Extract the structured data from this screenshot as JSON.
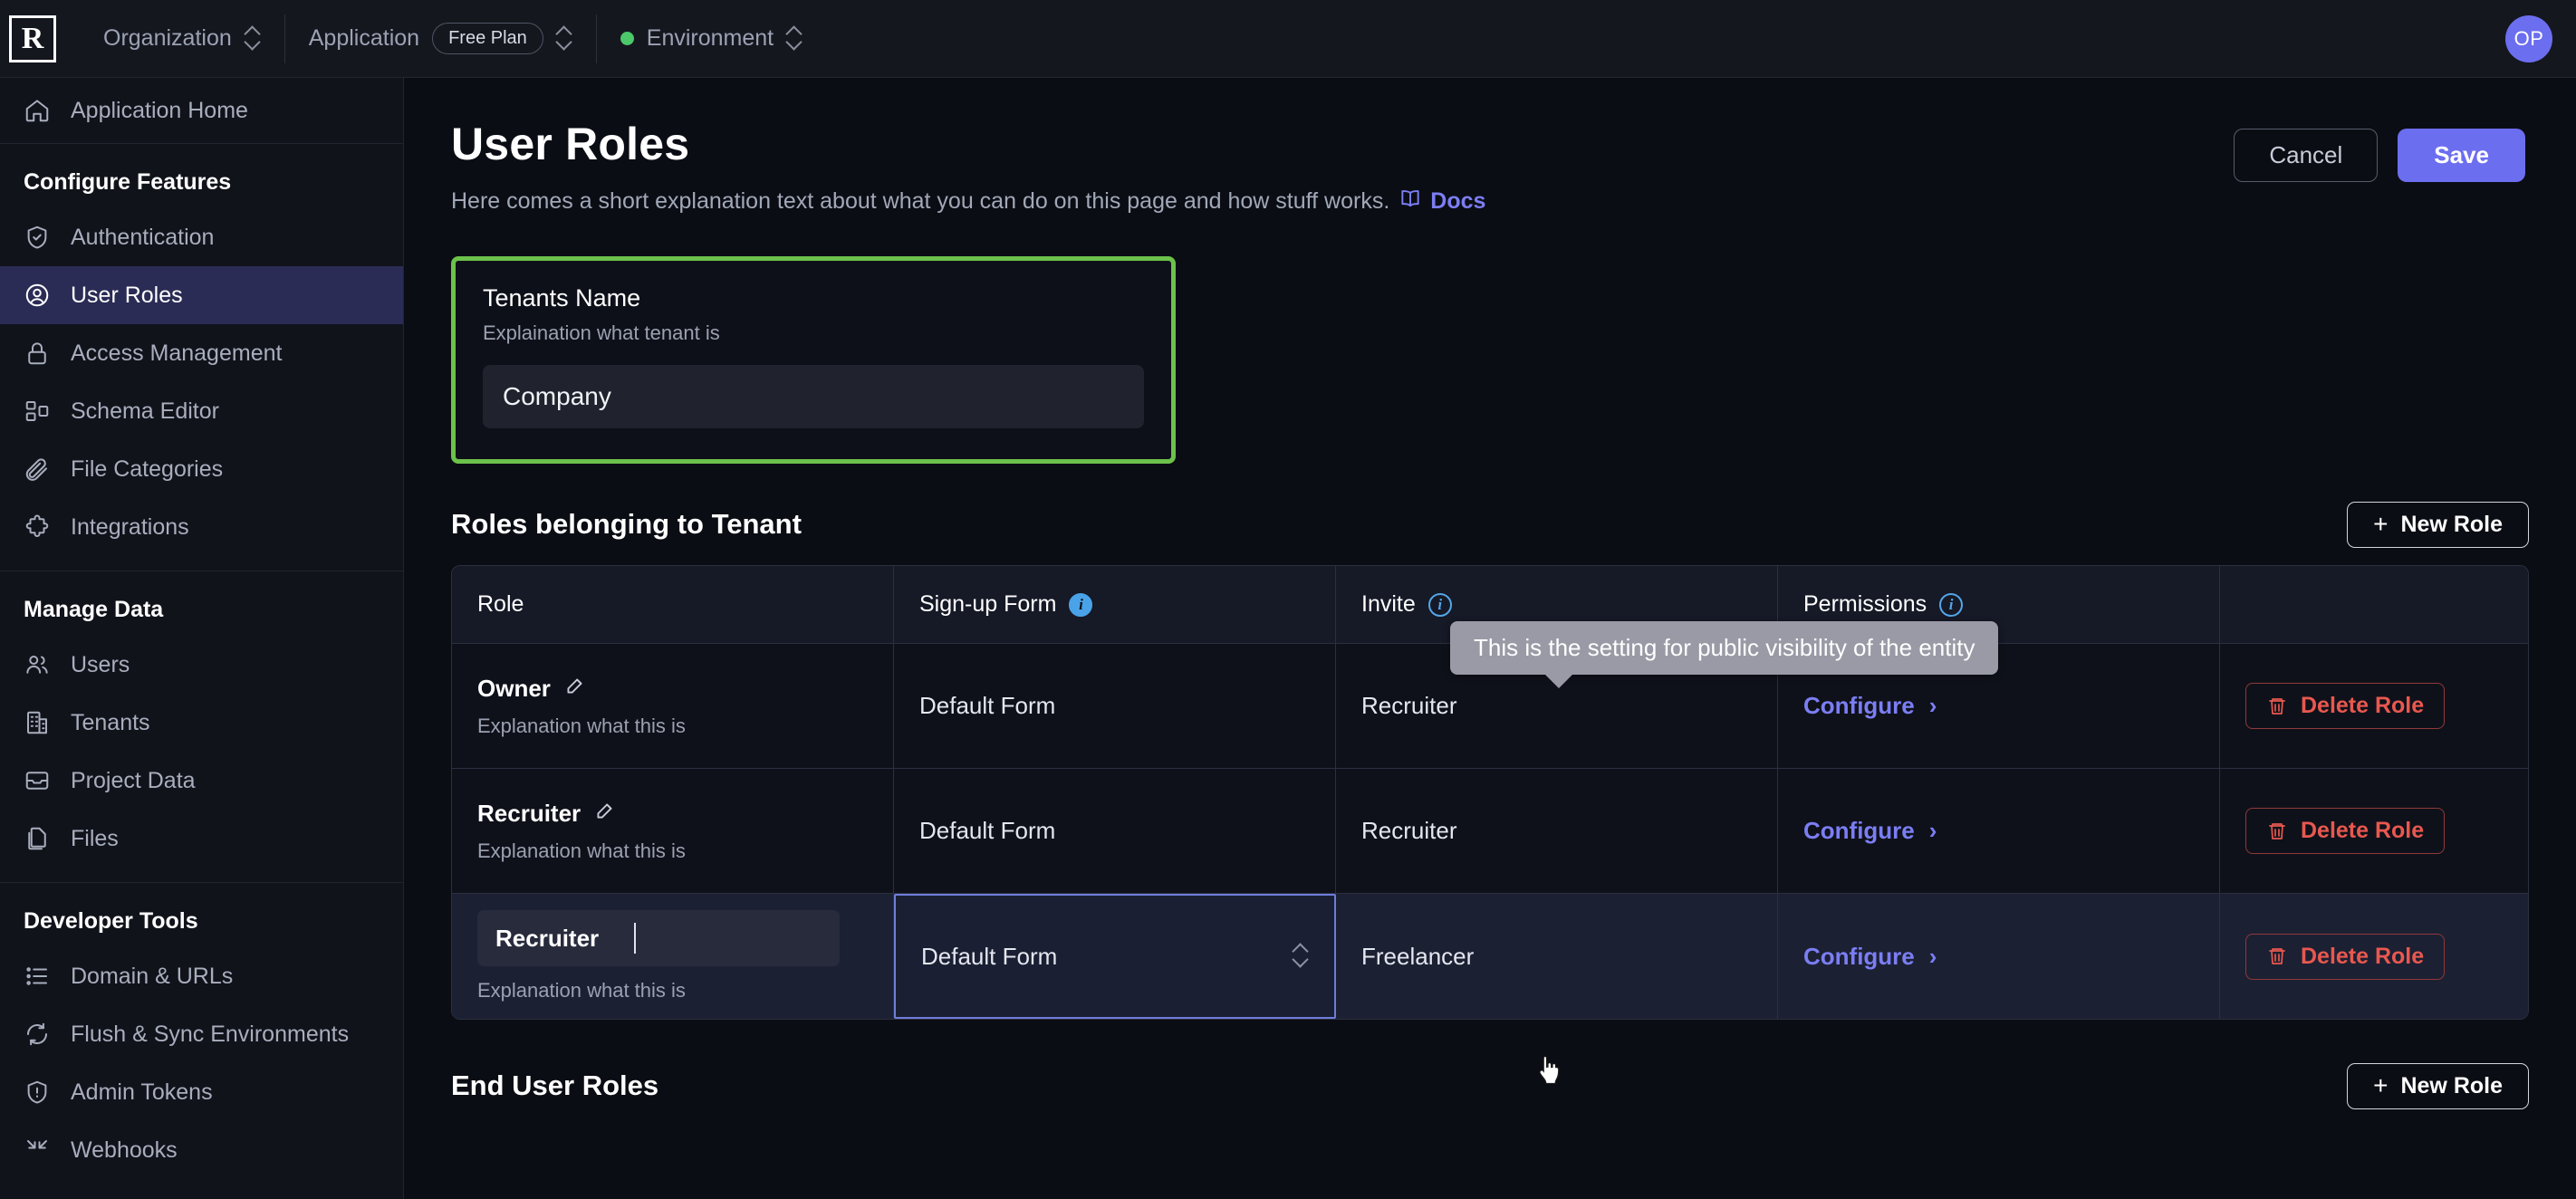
{
  "topbar": {
    "logo_text": "R",
    "org_label": "Organization",
    "app_label": "Application",
    "plan_badge": "Free Plan",
    "env_label": "Environment",
    "avatar_initials": "OP"
  },
  "sidebar": {
    "home_item": {
      "label": "Application Home",
      "icon": "home-icon"
    },
    "groups": [
      {
        "heading": "Configure Features",
        "items": [
          {
            "label": "Authentication",
            "icon": "shield-check-icon",
            "active": false
          },
          {
            "label": "User Roles",
            "icon": "user-circle-icon",
            "active": true
          },
          {
            "label": "Access Management",
            "icon": "lock-icon",
            "active": false
          },
          {
            "label": "Schema Editor",
            "icon": "schema-icon",
            "active": false
          },
          {
            "label": "File Categories",
            "icon": "paperclip-icon",
            "active": false
          },
          {
            "label": "Integrations",
            "icon": "puzzle-icon",
            "active": false
          }
        ]
      },
      {
        "heading": "Manage Data",
        "items": [
          {
            "label": "Users",
            "icon": "users-icon",
            "active": false
          },
          {
            "label": "Tenants",
            "icon": "building-icon",
            "active": false
          },
          {
            "label": "Project Data",
            "icon": "tray-icon",
            "active": false
          },
          {
            "label": "Files",
            "icon": "files-icon",
            "active": false
          }
        ]
      },
      {
        "heading": "Developer Tools",
        "items": [
          {
            "label": "Domain & URLs",
            "icon": "list-icon",
            "active": false
          },
          {
            "label": "Flush & Sync Environments",
            "icon": "refresh-icon",
            "active": false
          },
          {
            "label": "Admin Tokens",
            "icon": "shield-alert-icon",
            "active": false
          },
          {
            "label": "Webhooks",
            "icon": "webhook-icon",
            "active": false
          }
        ]
      }
    ]
  },
  "page": {
    "title": "User Roles",
    "subtitle": "Here comes a short explanation text about what you can do on this page and how stuff works.",
    "docs_label": "Docs",
    "cancel_label": "Cancel",
    "save_label": "Save"
  },
  "tenant_card": {
    "title": "Tenants Name",
    "description": "Explaination what tenant is",
    "input_value": "Company",
    "highlight_color": "#6cc24a"
  },
  "tooltip": {
    "text": "This is the setting for public visibility of the entity"
  },
  "roles_section": {
    "title": "Roles belonging to Tenant",
    "new_role_label": "New Role",
    "columns": [
      "Role",
      "Sign-up Form",
      "Invite",
      "Permissions",
      ""
    ],
    "rows": [
      {
        "role": "Owner",
        "role_desc": "Explanation what this is",
        "signup_form": "Default Form",
        "invite": "Recruiter",
        "permissions_label": "Configure",
        "delete_label": "Delete Role",
        "editing": false,
        "selected": false
      },
      {
        "role": "Recruiter",
        "role_desc": "Explanation what this is",
        "signup_form": "Default Form",
        "invite": "Recruiter",
        "permissions_label": "Configure",
        "delete_label": "Delete Role",
        "editing": false,
        "selected": false
      },
      {
        "role": "Recruiter",
        "role_desc": "Explanation what this is",
        "signup_form": "Default Form",
        "invite": "Freelancer",
        "permissions_label": "Configure",
        "delete_label": "Delete Role",
        "editing": true,
        "selected": true
      }
    ]
  },
  "end_user_section": {
    "title": "End User Roles",
    "new_role_label": "New Role"
  },
  "colors": {
    "accent": "#6c6ef0",
    "danger": "#e8584f",
    "link": "#7b7ef3",
    "info": "#54a6e8",
    "success": "#4cc76a",
    "highlight": "#6cc24a"
  }
}
